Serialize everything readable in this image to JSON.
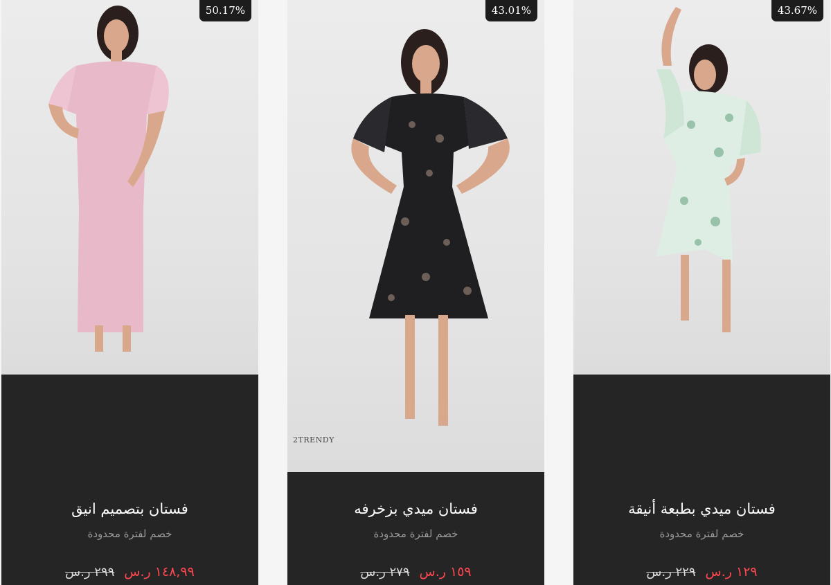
{
  "products": [
    {
      "discount": "50.17%",
      "name": "فستان بتصميم انيق",
      "subtitle": "خصم لفترة محدودة",
      "price": "١٤٨,٩٩ ر.س",
      "old_price": "٢٩٩ ر.س",
      "image": "pink-lace-maxi-dress-photo"
    },
    {
      "discount": "43.01%",
      "name": "فستان ميدي بزخرفه",
      "subtitle": "خصم لفترة محدودة",
      "price": "١٥٩ ر.س",
      "old_price": "٢٧٩ ر.س",
      "image": "black-floral-midi-dress-photo",
      "watermark": "2TRENDY"
    },
    {
      "discount": "43.67%",
      "name": "فستان ميدي بطبعة أنيقة",
      "subtitle": "خصم لفترة محدودة",
      "price": "١٢٩ ر.س",
      "old_price": "٢٢٩ ر.س",
      "image": "green-print-midi-dress-photo"
    }
  ],
  "colors": {
    "card_bg": "#252525",
    "sale_price": "#ff4752",
    "badge_bg": "#1c1c1c"
  }
}
